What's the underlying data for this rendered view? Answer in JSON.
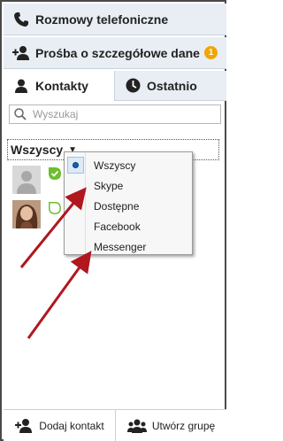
{
  "nav": {
    "calls_label": "Rozmowy telefoniczne",
    "request_label": "Prośba o szczegółowe dane",
    "request_badge": "1"
  },
  "tabs": {
    "contacts_label": "Kontakty",
    "recent_label": "Ostatnio"
  },
  "search": {
    "placeholder": "Wyszukaj"
  },
  "filter": {
    "selected": "Wszyscy"
  },
  "menu": {
    "items": [
      {
        "label": "Wszyscy",
        "checked": true
      },
      {
        "label": "Skype",
        "checked": false
      },
      {
        "label": "Dostępne",
        "checked": false
      },
      {
        "label": "Facebook",
        "checked": false
      },
      {
        "label": "Messenger",
        "checked": false
      }
    ]
  },
  "bottom": {
    "add_contact_label": "Dodaj kontakt",
    "create_group_label": "Utwórz grupę"
  },
  "colors": {
    "accent_badge": "#f0a500",
    "nav_bg": "#e8eef4",
    "annotation_arrow": "#b0171f",
    "status_online": "#6cbf2d"
  },
  "icons": {
    "calls": "phone-icon",
    "request": "add-person-icon",
    "contacts_tab": "person-icon",
    "recent_tab": "clock-icon",
    "search": "search-icon",
    "add_contact": "add-person-icon",
    "create_group": "group-icon"
  }
}
